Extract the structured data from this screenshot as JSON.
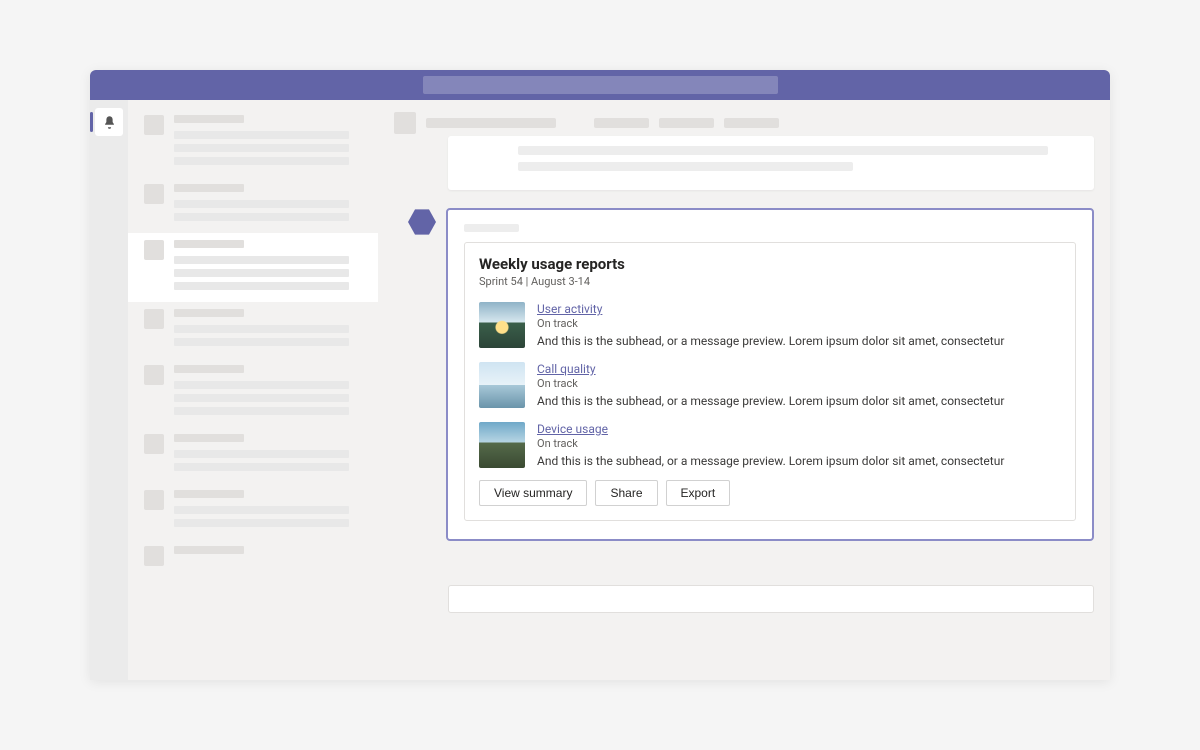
{
  "colors": {
    "accent": "#6264a7"
  },
  "rail": {
    "active_icon": "bell-icon"
  },
  "card": {
    "title": "Weekly usage reports",
    "subtitle": "Sprint 54  |  August 3-14",
    "reports": [
      {
        "title": "User activity",
        "status": "On track",
        "desc": "And this is the subhead, or a message preview. Lorem ipsum dolor sit amet, consectetur"
      },
      {
        "title": "Call quality",
        "status": "On track",
        "desc": "And this is the subhead, or a message preview. Lorem ipsum dolor sit amet, consectetur"
      },
      {
        "title": "Device usage",
        "status": "On track",
        "desc": "And this is the subhead, or a message preview. Lorem ipsum dolor sit amet, consectetur"
      }
    ],
    "buttons": {
      "view": "View summary",
      "share": "Share",
      "export": "Export"
    }
  }
}
